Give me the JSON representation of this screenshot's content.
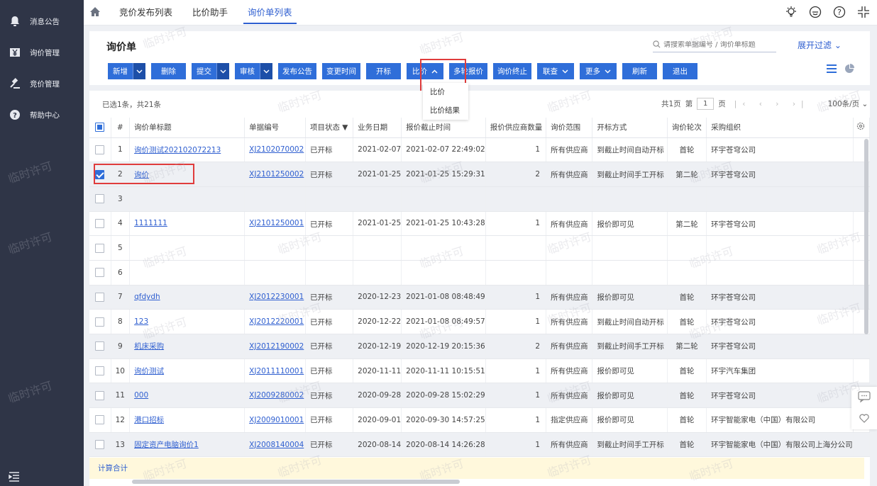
{
  "sidebar": {
    "items": [
      {
        "label": "消息公告",
        "icon": "bell-icon"
      },
      {
        "label": "询价管理",
        "icon": "yen-icon"
      },
      {
        "label": "竞价管理",
        "icon": "gavel-icon"
      },
      {
        "label": "帮助中心",
        "icon": "help-icon"
      }
    ]
  },
  "topbar": {
    "tabs": [
      "竞价发布列表",
      "比价助手",
      "询价单列表"
    ],
    "active_tab": 2
  },
  "header": {
    "title": "询价单",
    "search_placeholder": "请搜索单据编号 / 询价单标题",
    "expand_filter": "展开过滤"
  },
  "toolbar": {
    "add": "新增",
    "delete": "删除",
    "submit": "提交",
    "audit": "审核",
    "publish": "发布公告",
    "change_time": "变更时间",
    "open_bid": "开标",
    "compare": "比价",
    "multi_round": "多轮报价",
    "terminate": "询价终止",
    "query": "联查",
    "more": "更多",
    "refresh": "刷新",
    "exit": "退出"
  },
  "dropdown": {
    "items": [
      "比价",
      "比价结果"
    ]
  },
  "grid": {
    "selection_info": "已选1条，共21条",
    "pager": {
      "total_pages": "共1页",
      "page_prefix": "第",
      "page": "1",
      "page_suffix": "页",
      "page_size": "100条/页"
    },
    "columns": [
      "#",
      "询价单标题",
      "单据编号",
      "项目状态",
      "业务日期",
      "报价截止时间",
      "报价供应商数量",
      "询价范围",
      "开标方式",
      "询价轮次",
      "采购组织"
    ],
    "rows": [
      {
        "idx": "1",
        "title": "询价测试202102072213",
        "code": "XJ2102070002",
        "status": "已开标",
        "date": "2021-02-07",
        "deadline": "2021-02-07 22:49:02",
        "count": "1",
        "range": "所有供应商",
        "open": "到截止时间自动开标",
        "round": "首轮",
        "org": "环宇苍穹公司"
      },
      {
        "idx": "2",
        "title": "询价",
        "code": "XJ2101250002",
        "status": "已开标",
        "date": "2021-01-25",
        "deadline": "2021-01-25 15:29:31",
        "count": "2",
        "range": "所有供应商",
        "open": "到截止时间手工开标",
        "round": "第二轮",
        "org": "环宇苍穹公司"
      },
      {
        "idx": "3",
        "title": "",
        "code": "",
        "status": "",
        "date": "",
        "deadline": "",
        "count": "",
        "range": "",
        "open": "",
        "round": "",
        "org": ""
      },
      {
        "idx": "4",
        "title": "1111111",
        "code": "XJ2101250001",
        "status": "已开标",
        "date": "2021-01-25",
        "deadline": "2021-01-25 10:43:28",
        "count": "1",
        "range": "所有供应商",
        "open": "报价即可见",
        "round": "第二轮",
        "org": "环宇苍穹公司"
      },
      {
        "idx": "5",
        "title": "",
        "code": "",
        "status": "",
        "date": "",
        "deadline": "",
        "count": "",
        "range": "",
        "open": "",
        "round": "",
        "org": ""
      },
      {
        "idx": "6",
        "title": "",
        "code": "",
        "status": "",
        "date": "",
        "deadline": "",
        "count": "",
        "range": "",
        "open": "",
        "round": "",
        "org": ""
      },
      {
        "idx": "7",
        "title": "qfdydh",
        "code": "XJ2012230001",
        "status": "已开标",
        "date": "2020-12-23",
        "deadline": "2021-01-08 08:48:49",
        "count": "1",
        "range": "所有供应商",
        "open": "报价即可见",
        "round": "首轮",
        "org": "环宇苍穹公司"
      },
      {
        "idx": "8",
        "title": "123",
        "code": "XJ2012220001",
        "status": "已开标",
        "date": "2020-12-22",
        "deadline": "2021-01-08 08:49:57",
        "count": "1",
        "range": "所有供应商",
        "open": "到截止时间自动开标",
        "round": "首轮",
        "org": "环宇苍穹公司"
      },
      {
        "idx": "9",
        "title": "机床采购",
        "code": "XJ2012190002",
        "status": "已开标",
        "date": "2020-12-19",
        "deadline": "2020-12-19 20:15:36",
        "count": "2",
        "range": "所有供应商",
        "open": "到截止时间手工开标",
        "round": "第二轮",
        "org": "环宇苍穹公司"
      },
      {
        "idx": "10",
        "title": "询价测试",
        "code": "XJ2011110001",
        "status": "已开标",
        "date": "2020-11-11",
        "deadline": "2020-11-11 10:15:51",
        "count": "1",
        "range": "所有供应商",
        "open": "报价即可见",
        "round": "首轮",
        "org": "环宇汽车集团"
      },
      {
        "idx": "11",
        "title": "000",
        "code": "XJ2009280002",
        "status": "已开标",
        "date": "2020-09-28",
        "deadline": "2020-09-28 15:02:29",
        "count": "1",
        "range": "所有供应商",
        "open": "报价即可见",
        "round": "首轮",
        "org": "环宇苍穹公司"
      },
      {
        "idx": "12",
        "title": "港口招标",
        "code": "XJ2009010001",
        "status": "已开标",
        "date": "2020-09-01",
        "deadline": "2020-09-30 14:57:25",
        "count": "1",
        "range": "指定供应商",
        "open": "报价即可见",
        "round": "首轮",
        "org": "环宇智能家电（中国）有限公司"
      },
      {
        "idx": "13",
        "title": "固定资产电脑询价1",
        "code": "XJ2008140004",
        "status": "已开标",
        "date": "2020-08-14",
        "deadline": "2020-08-14 14:26:28",
        "count": "1",
        "range": "所有供应商",
        "open": "到截止时间手工开标",
        "round": "首轮",
        "org": "环宇智能家电（中国）有限公司上海分公司"
      }
    ],
    "sum_label": "计算合计"
  },
  "watermark": "临时许可",
  "colors": {
    "primary": "#2f6ed9",
    "sidebar": "#2f3547",
    "highlight": "#e03c3c",
    "link": "#2f5fd0"
  }
}
